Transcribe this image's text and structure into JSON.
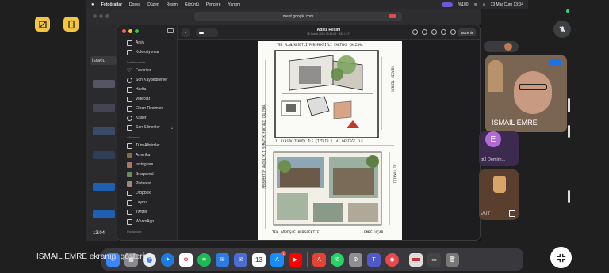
{
  "meet": {
    "presenter_text": "İSMAİL EMRE ekranını gösteriyor",
    "participant_name": "İSMAİL EMRE",
    "avatar_letter": "E",
    "participant_partial_label": "gül Demirh...",
    "participant_partial_label2": "VUT",
    "colors": {
      "accent": "#f4c542",
      "bg": "#1f1f1f"
    }
  },
  "menubar": {
    "app": "Fotoğraflar",
    "menus": [
      "Dosya",
      "Düzen",
      "Resim",
      "Görüntü",
      "Pencere",
      "Yardım"
    ],
    "battery": "%100",
    "datetime": "13 Mar Cum  13:04"
  },
  "browser": {
    "url": "meet.google.com"
  },
  "photos": {
    "doc_title": "Adsız Resim",
    "doc_subtitle": "18 Şubat 2026 03:16:09  ·  432 / 471",
    "edit_label": "Düzenle",
    "sidebar": {
      "top_items": [
        {
          "label": "Arşiv",
          "icon": "archive-icon"
        },
        {
          "label": "Koleksiyonlar",
          "icon": "collections-icon"
        }
      ],
      "section_pinned": "Sabitlenenler",
      "pinned_items": [
        {
          "label": "Favoriler",
          "icon": "heart-icon"
        },
        {
          "label": "Son Kaydedilenler",
          "icon": "clock-icon"
        },
        {
          "label": "Harita",
          "icon": "map-icon"
        },
        {
          "label": "Videolar",
          "icon": "video-icon"
        },
        {
          "label": "Ekran Resimleri",
          "icon": "screenshot-icon"
        },
        {
          "label": "Kişiler",
          "icon": "person-icon"
        },
        {
          "label": "Son Silinenler",
          "icon": "trash-icon"
        }
      ],
      "section_albums": "Albümler",
      "album_items": [
        {
          "label": "Tüm Albümler",
          "icon": "albums-icon"
        },
        {
          "label": "Amerika",
          "icon": "album-thumb-icon"
        },
        {
          "label": "Instagram",
          "icon": "album-thumb-icon"
        },
        {
          "label": "Snapseed",
          "icon": "album-thumb-icon"
        },
        {
          "label": "Pinterest",
          "icon": "album-thumb-icon"
        },
        {
          "label": "Dropbox",
          "icon": "folder-icon"
        },
        {
          "label": "Layout",
          "icon": "folder-icon"
        },
        {
          "label": "Twitter",
          "icon": "folder-icon"
        },
        {
          "label": "WhatsApp",
          "icon": "folder-icon"
        }
      ],
      "section_shared": "Paylaşılan"
    },
    "sheet": {
      "top_heading": "TEK PLAN/KESİTLİ/PERSPEKTİFLİ FAKTAKI ÇALIŞMA",
      "side_left": "PERSPEKTİF AĞIRLIKLI ŞEMATİK FAKTAKI ÇALIŞMA",
      "side_right_1": "KLASİK TEKNİK",
      "side_right_2": "AI TEKNİĞİ",
      "middle_caption": "1. KLASİK TEKNİK İLE ÇİZİLİP 2. AI DESTEĞİ İLE",
      "bottom_left": "TEK GÖRÜŞLE PERSPEKTİF",
      "bottom_right": "EMRE UÇAR"
    }
  },
  "bg_window": {
    "time": "13:04",
    "tab": "İSMAİL"
  },
  "dock": {
    "calendar_day": "13",
    "appstore_badge": "1",
    "items": [
      "finder-icon",
      "launchpad-icon",
      "chrome-icon",
      "safari-icon",
      "photos-icon",
      "spotify-icon",
      "mail-icon",
      "mail2-icon",
      "calendar-icon",
      "appstore-icon",
      "youtube-icon",
      "acrobat-icon",
      "whatsapp-icon",
      "settings-icon",
      "teams-icon",
      "color-icon",
      "doc-icon",
      "browser-icon",
      "trash-icon"
    ]
  }
}
